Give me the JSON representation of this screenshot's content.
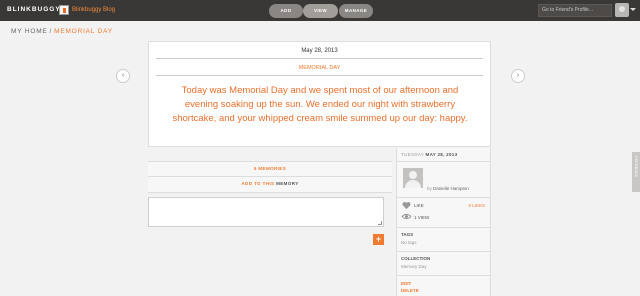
{
  "topbar": {
    "logo": "BLINKBUGGY",
    "blog_link": "Blinkbuggy Blog",
    "nav": [
      "ADD",
      "VIEW",
      "MANAGE"
    ],
    "friend_search_placeholder": "Go to Friend's Profile..."
  },
  "breadcrumb": {
    "home": "MY HOME",
    "separator": "/",
    "current": "MEMORIAL DAY"
  },
  "memory": {
    "date": "May 28, 2013",
    "collection": "MEMORIAL DAY",
    "text": "Today was Memorial Day and we spent most of our afternoon and evening soaking up the sun. We ended our night with strawberry shortcake, and your whipped cream smile summed up our day: happy."
  },
  "actions": {
    "memories": "5 MEMORIES",
    "add_to_this": "ADD TO THIS",
    "memory_word": "MEMORY",
    "add_button": "+"
  },
  "sidebar": {
    "day": "TUESDAY",
    "date": "MAY 28, 2013",
    "by": "by",
    "author": "Danielle Hampton",
    "like_label": "LIKE",
    "likes_count": "0 LIKES",
    "views": "1 VIEW",
    "tags_label": "TAGS",
    "tags_value": "No tags",
    "collection_label": "COLLECTION",
    "collection_value": "Memory Day",
    "edit": "EDIT",
    "delete": "DELETE"
  },
  "feedback": "FEEDBACK",
  "colors": {
    "accent": "#f07a30",
    "topbar": "#3a3836"
  },
  "icons": [
    "blog-icon",
    "avatar-icon",
    "chevron-left-icon",
    "chevron-right-icon",
    "heart-icon",
    "eye-icon",
    "plus-icon"
  ]
}
